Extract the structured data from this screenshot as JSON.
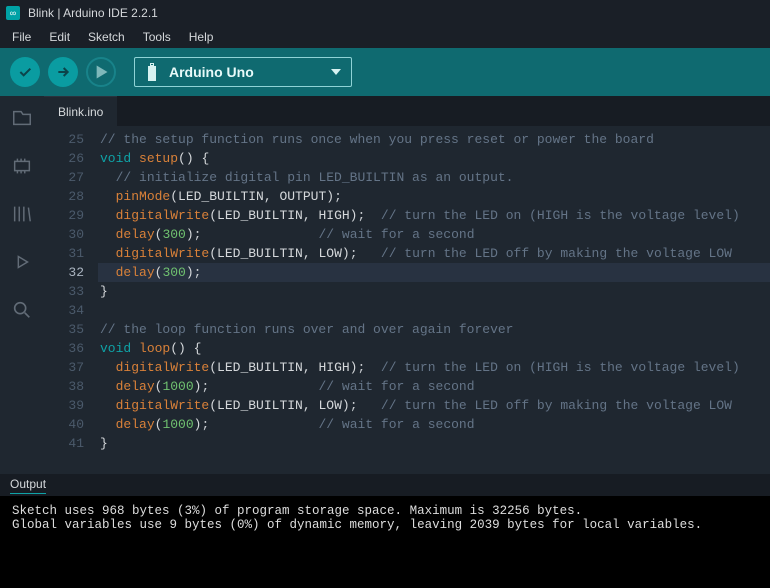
{
  "window": {
    "title": "Blink | Arduino IDE 2.2.1"
  },
  "menu": {
    "items": [
      "File",
      "Edit",
      "Sketch",
      "Tools",
      "Help"
    ]
  },
  "toolbar": {
    "board": "Arduino Uno"
  },
  "tabs": {
    "active": "Blink.ino"
  },
  "editor": {
    "highlight_line": 32,
    "lines": [
      {
        "n": 25,
        "t": "comment",
        "text": "// the setup function runs once when you press reset or power the board"
      },
      {
        "n": 26,
        "t": "sig",
        "kw": "void",
        "fn": "setup",
        "rest": "() {"
      },
      {
        "n": 27,
        "t": "comment",
        "indent": "  ",
        "text": "// initialize digital pin LED_BUILTIN as an output."
      },
      {
        "n": 28,
        "t": "call",
        "indent": "  ",
        "fn": "pinMode",
        "args": "LED_BUILTIN, OUTPUT",
        "tail": ";"
      },
      {
        "n": 29,
        "t": "call",
        "indent": "  ",
        "fn": "digitalWrite",
        "args": "LED_BUILTIN, HIGH",
        "tail": ";",
        "pad": "  ",
        "comment": "// turn the LED on (HIGH is the voltage level)"
      },
      {
        "n": 30,
        "t": "delay",
        "indent": "  ",
        "fn": "delay",
        "num": "300",
        "tail": ";",
        "pad": "               ",
        "comment": "// wait for a second"
      },
      {
        "n": 31,
        "t": "call",
        "indent": "  ",
        "fn": "digitalWrite",
        "args": "LED_BUILTIN, LOW",
        "tail": ";",
        "pad": "   ",
        "comment": "// turn the LED off by making the voltage LOW"
      },
      {
        "n": 32,
        "t": "delay",
        "indent": "  ",
        "fn": "delay",
        "num": "300",
        "tail": ";"
      },
      {
        "n": 33,
        "t": "plain",
        "text": "}"
      },
      {
        "n": 34,
        "t": "plain",
        "text": ""
      },
      {
        "n": 35,
        "t": "comment",
        "text": "// the loop function runs over and over again forever"
      },
      {
        "n": 36,
        "t": "sig",
        "kw": "void",
        "fn": "loop",
        "rest": "() {"
      },
      {
        "n": 37,
        "t": "call",
        "indent": "  ",
        "fn": "digitalWrite",
        "args": "LED_BUILTIN, HIGH",
        "tail": ";",
        "pad": "  ",
        "comment": "// turn the LED on (HIGH is the voltage level)"
      },
      {
        "n": 38,
        "t": "delay",
        "indent": "  ",
        "fn": "delay",
        "num": "1000",
        "tail": ";",
        "pad": "              ",
        "comment": "// wait for a second"
      },
      {
        "n": 39,
        "t": "call",
        "indent": "  ",
        "fn": "digitalWrite",
        "args": "LED_BUILTIN, LOW",
        "tail": ";",
        "pad": "   ",
        "comment": "// turn the LED off by making the voltage LOW"
      },
      {
        "n": 40,
        "t": "delay",
        "indent": "  ",
        "fn": "delay",
        "num": "1000",
        "tail": ";",
        "pad": "              ",
        "comment": "// wait for a second"
      },
      {
        "n": 41,
        "t": "plain",
        "text": "}"
      }
    ]
  },
  "output": {
    "label": "Output",
    "lines": [
      "Sketch uses 968 bytes (3%) of program storage space. Maximum is 32256 bytes.",
      "Global variables use 9 bytes (0%) of dynamic memory, leaving 2039 bytes for local variables."
    ]
  }
}
